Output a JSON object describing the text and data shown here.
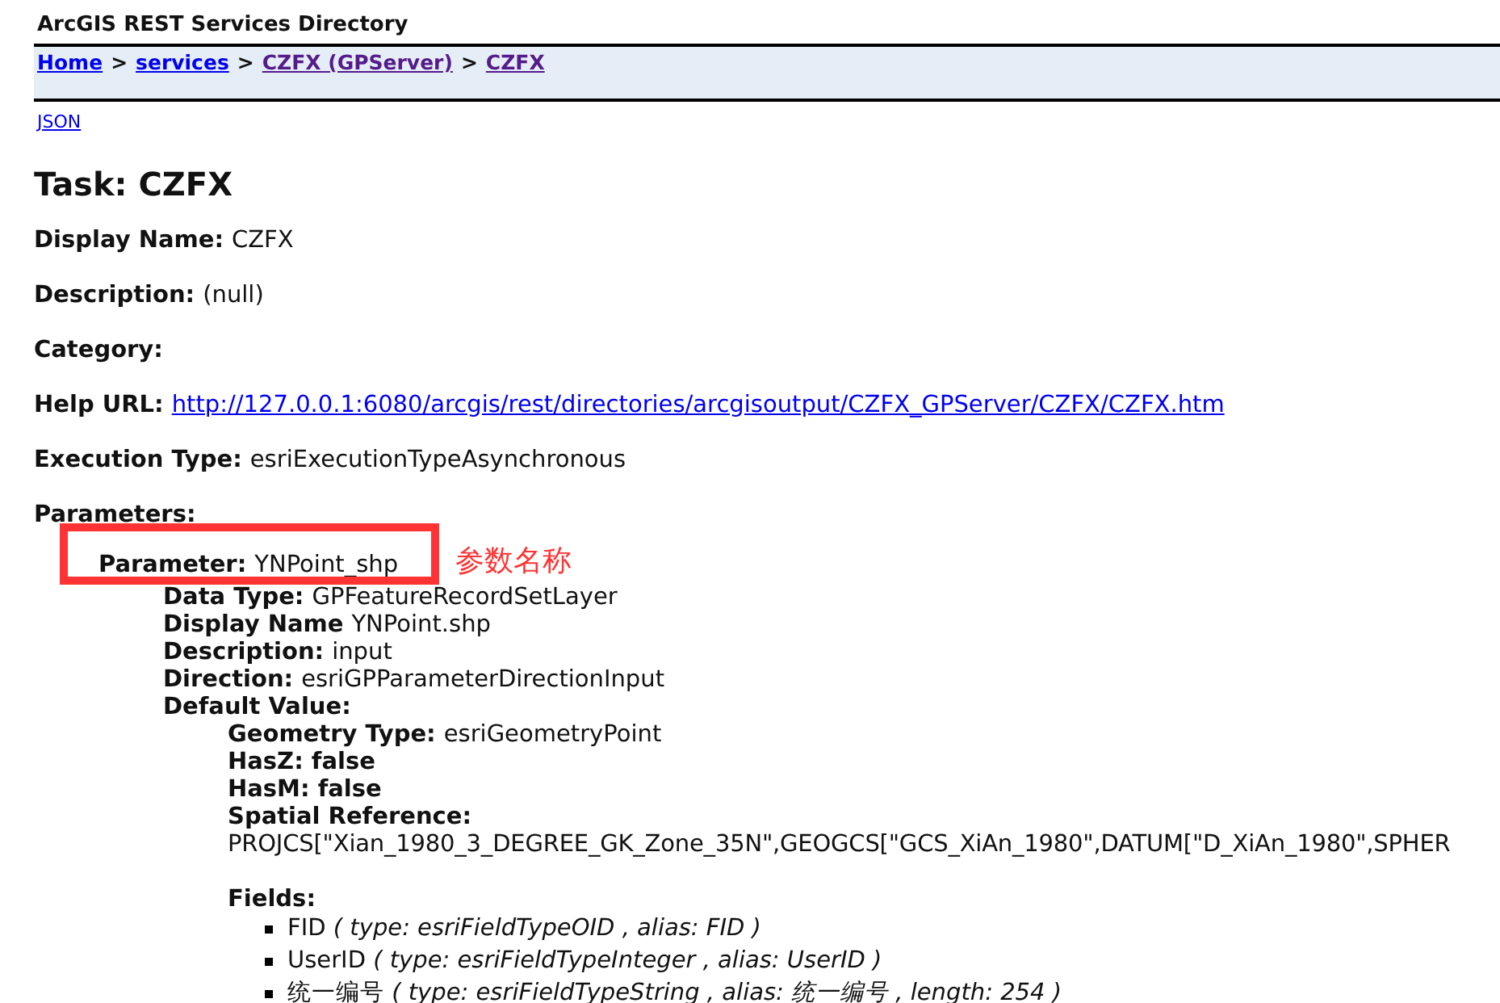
{
  "header": {
    "title": "ArcGIS REST Services Directory"
  },
  "breadcrumb": [
    {
      "label": "Home",
      "visited": false
    },
    {
      "label": "services",
      "visited": false
    },
    {
      "label": "CZFX (GPServer)",
      "visited": true
    },
    {
      "label": "CZFX",
      "visited": true
    }
  ],
  "breadcrumb_separator": ">",
  "json_link": "JSON",
  "task_title": "Task: CZFX",
  "properties": [
    {
      "label": "Display Name:",
      "value": "CZFX",
      "kind": "text"
    },
    {
      "label": "Description:",
      "value": "(null)",
      "kind": "text"
    },
    {
      "label": "Category:",
      "kind": "empty"
    },
    {
      "label": "Help URL:",
      "value": "http://127.0.0.1:6080/arcgis/rest/directories/arcgisoutput/CZFX_GPServer/CZFX/CZFX.htm",
      "kind": "link"
    },
    {
      "label": "Execution Type:",
      "value": "esriExecutionTypeAsynchronous",
      "kind": "text"
    },
    {
      "label": "Parameters:",
      "kind": "empty"
    }
  ],
  "parameter": {
    "label": "Parameter:",
    "value": "YNPoint_shp",
    "details": [
      {
        "label": "Data Type:",
        "value": "GPFeatureRecordSetLayer"
      },
      {
        "label": "Display Name",
        "value": "YNPoint.shp"
      },
      {
        "label": "Description:",
        "value": "input"
      },
      {
        "label": "Direction:",
        "value": "esriGPParameterDirectionInput"
      },
      {
        "label": "Default Value:"
      }
    ],
    "default_value": [
      {
        "label": "Geometry Type:",
        "value": "esriGeometryPoint"
      },
      {
        "label": "HasZ: false"
      },
      {
        "label": "HasM: false"
      },
      {
        "label": "Spatial Reference:"
      }
    ],
    "spatial_reference": "PROJCS[\"Xian_1980_3_DEGREE_GK_Zone_35N\",GEOGCS[\"GCS_XiAn_1980\",DATUM[\"D_XiAn_1980\",SPHER",
    "fields_label": "Fields:",
    "fields": [
      {
        "text": "FID *( type: esriFieldTypeOID , alias: FID )*"
      },
      {
        "text": "UserID *( type: esriFieldTypeInteger , alias: UserID )*"
      },
      {
        "text": "统一编号 *( type: esriFieldTypeString , alias: 统一编号 , length: 254 )*"
      }
    ]
  },
  "annotation": {
    "text": "参数名称",
    "color": "#ff3333"
  }
}
